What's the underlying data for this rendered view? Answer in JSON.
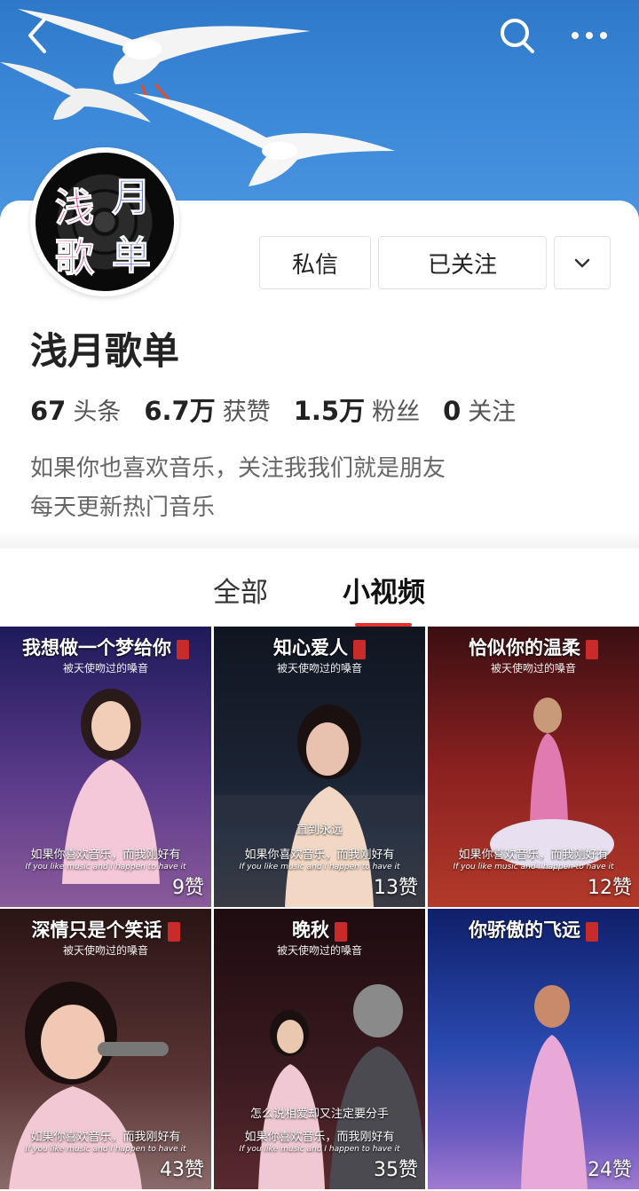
{
  "topbar": {
    "back_icon": "chevron-left-icon",
    "search_icon": "search-icon",
    "more_icon": "more-dots-icon"
  },
  "profile": {
    "avatar_chars": [
      "浅",
      "月",
      "歌",
      "单"
    ],
    "name": "浅月歌单",
    "message_label": "私信",
    "follow_label": "已关注",
    "stats": [
      {
        "num": "67",
        "label": "头条"
      },
      {
        "num": "6.7万",
        "label": "获赞"
      },
      {
        "num": "1.5万",
        "label": "粉丝"
      },
      {
        "num": "0",
        "label": "关注"
      }
    ],
    "bio": [
      "如果你也喜欢音乐，关注我我们就是朋友",
      "每天更新热门音乐"
    ]
  },
  "tabs": [
    {
      "label": "全部"
    },
    {
      "label": "小视频"
    }
  ],
  "videos": [
    {
      "title": "我想做一个梦给你",
      "subtitle": "被天使吻过的嗓音",
      "caption1": "如果你喜欢音乐，而我刚好有",
      "caption2": "If you like music and I happen to have it",
      "mid": "",
      "likes": "9赞",
      "bg": "#3a2b78"
    },
    {
      "title": "知心爱人",
      "subtitle": "被天使吻过的嗓音",
      "caption1": "如果你喜欢音乐，而我刚好有",
      "caption2": "If you like music and I happen to have it",
      "mid": "直到永远",
      "likes": "13赞",
      "bg": "#1c2230"
    },
    {
      "title": "恰似你的温柔",
      "subtitle": "被天使吻过的嗓音",
      "caption1": "如果你喜欢音乐，而我刚好有",
      "caption2": "If you like music and I happen to have it",
      "mid": "",
      "likes": "12赞",
      "bg": "#6e1a1a"
    },
    {
      "title": "深情只是个笑话",
      "subtitle": "被天使吻过的嗓音",
      "caption1": "如果你喜欢音乐，而我刚好有",
      "caption2": "If you like music and I happen to have it",
      "mid": "",
      "likes": "43赞",
      "bg": "#4a2a2a"
    },
    {
      "title": "晚秋",
      "subtitle": "被天使吻过的嗓音",
      "caption1": "如果你喜欢音乐，而我刚好有",
      "caption2": "If you like music and I happen to have it",
      "mid": "怎么说相爱却又注定要分手",
      "likes": "35赞",
      "bg": "#2a1418"
    },
    {
      "title": "你骄傲的飞远",
      "subtitle": "",
      "caption1": "",
      "caption2": "",
      "mid": "",
      "likes": "24赞",
      "bg": "#1d3a9a"
    }
  ],
  "colors": {
    "accent": "#e8322e",
    "banner": "#3a87d8"
  }
}
